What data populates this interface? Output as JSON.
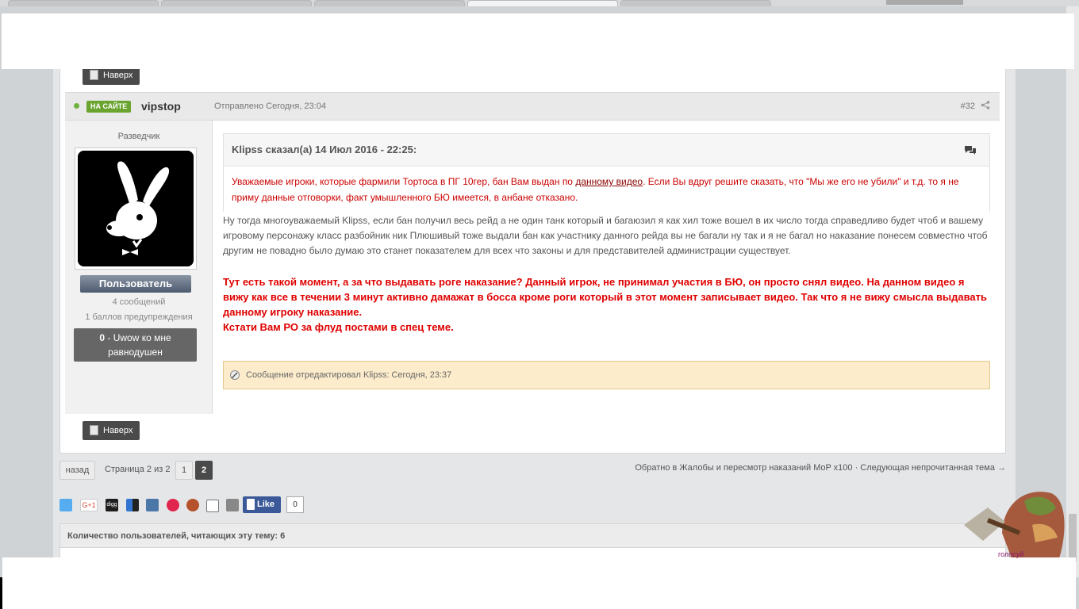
{
  "top_button": {
    "label": "Наверх"
  },
  "post": {
    "online_badge": "НА САЙТЕ",
    "author": "vipstop",
    "posted": "Отправлено Сегодня, 23:04",
    "number": "#32"
  },
  "user": {
    "title": "Разведчик",
    "group": "Пользователь",
    "posts": "4 сообщений",
    "warnings": "1 баллов предупреждения",
    "rep_value": "0",
    "rep_text_line1": " - Uwow ко мне",
    "rep_text_line2": "равнодушен"
  },
  "quote": {
    "header": "Klipss сказал(а) 14 Июл 2016 - 22:25:",
    "text_before_link": "Уважаемые игроки, которые фармили Тортоса в ПГ 10гер, бан Вам выдан по ",
    "link": "данному видео",
    "text_after_link": ". Если Вы вдруг решите сказать, что \"Мы же его не убили\" и т.д. то я не приму данные отговорки, факт умышленного БЮ имеется, в анбане отказано."
  },
  "body": {
    "text": "Ну тогда многоуважаемый Klipss, если бан получил весь рейд а не один танк который и багаюзил я как хил тоже вошел в их число тогда справедливо будет чтоб и вашему игровому персонажу класс разбойник ник Плюшивый тоже выдали бан как участнику данного рейда вы не багали ну так и я не багал но наказание понесем совместно чтоб другим не повадно было думаю это станет показателем для всех что законы и для представителей администрации существует.",
    "bold_line1": "Тут есть такой момент, а за что выдавать роге наказание? Данный игрок, не принимал участия в БЮ, он просто снял видео. На данном видео я вижу как все в течении 3 минут активно дамажат в босса кроме роги который в этот момент записывает видео. Так что я не вижу смысла выдавать данному игроку наказание.",
    "bold_line2": "Кстати Вам РО за флуд постами в спец теме.",
    "edit_note": "Сообщение отредактировал Klipss: Сегодня, 23:37"
  },
  "pagination": {
    "prev": "назад",
    "info": "Страница 2 из 2",
    "pages": [
      "1",
      "2"
    ],
    "current": "2",
    "back_link": "Обратно в Жалобы и пересмотр наказаний MoP x100 · Следующая непрочитанная тема →"
  },
  "share": {
    "fb_like": "Like",
    "fb_count": "0",
    "gplus_label": "G+1",
    "digg_label": "digg"
  },
  "readers": {
    "title": "Количество пользователей, читающих эту тему: 6"
  },
  "widget": {
    "label": "голосуй"
  }
}
